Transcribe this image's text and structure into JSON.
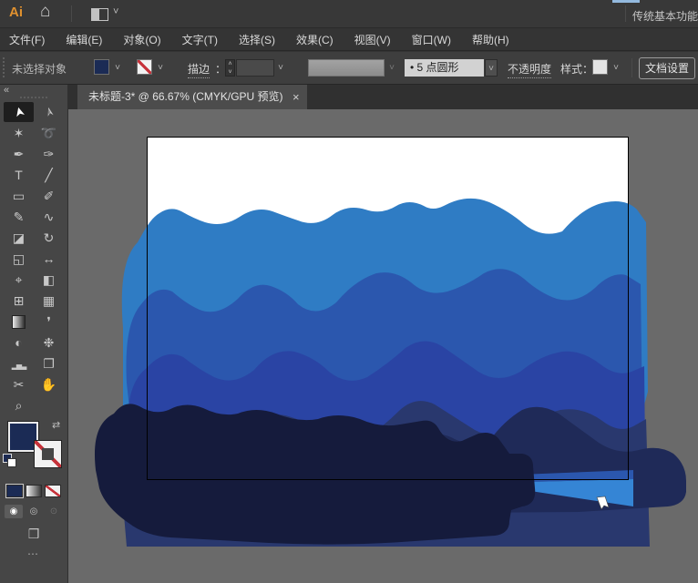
{
  "window": {
    "logo_text": "Ai",
    "workspace_label": "传统基本功能",
    "arrange_chevron": "˅"
  },
  "menu_bar": {
    "items": [
      "文件(F)",
      "编辑(E)",
      "对象(O)",
      "文字(T)",
      "选择(S)",
      "效果(C)",
      "视图(V)",
      "窗口(W)",
      "帮助(H)"
    ]
  },
  "control_bar": {
    "no_selection_label": "未选择对象",
    "fill_color": "#1B2B55",
    "stroke_label": "描边",
    "stroke_colon": "：",
    "stepper_up": "˄",
    "stepper_down": "˅",
    "chevron_glyph": "˅",
    "brush_value": "•  5 点圆形",
    "opacity_label": "不透明度",
    "style_label": "样式：",
    "doc_setup_label": "文档设置"
  },
  "document_tab": {
    "title": "未标题-3*  @  66.67%  (CMYK/GPU 预览)",
    "close_glyph": "×",
    "zoom_percent": "66.67%"
  },
  "toolbar": {
    "collapse_glyph": "«",
    "swap_glyph": "⇄",
    "screen_mode_glyph": "❒",
    "more_glyph": "⋯",
    "drawing_modes": [
      "◉",
      "◎",
      "⊙"
    ],
    "tools": [
      {
        "id": "selection",
        "glyph": "➤",
        "selected": true,
        "cls": "rot"
      },
      {
        "id": "direct-selection",
        "glyph": "➢",
        "cls": "rot"
      },
      {
        "id": "magic-wand",
        "glyph": "✶"
      },
      {
        "id": "lasso",
        "glyph": "➰"
      },
      {
        "id": "pen",
        "glyph": "✒"
      },
      {
        "id": "curvature",
        "glyph": "✑"
      },
      {
        "id": "type",
        "glyph": "T"
      },
      {
        "id": "line-segment",
        "glyph": "╱"
      },
      {
        "id": "rectangle",
        "glyph": "▭"
      },
      {
        "id": "paintbrush",
        "glyph": "✐"
      },
      {
        "id": "pencil",
        "glyph": "✎"
      },
      {
        "id": "shaper",
        "glyph": "∿"
      },
      {
        "id": "eraser",
        "glyph": "◪"
      },
      {
        "id": "rotate",
        "glyph": "↻"
      },
      {
        "id": "scale",
        "glyph": "◱"
      },
      {
        "id": "width",
        "glyph": "↔"
      },
      {
        "id": "puppet-warp",
        "glyph": "⌖"
      },
      {
        "id": "shape-builder",
        "glyph": "◧"
      },
      {
        "id": "perspective-grid",
        "glyph": "⊞"
      },
      {
        "id": "mesh",
        "glyph": "▦"
      },
      {
        "id": "gradient",
        "grad": true
      },
      {
        "id": "eyedropper",
        "glyph": "❜"
      },
      {
        "id": "blend",
        "glyph": "◐"
      },
      {
        "id": "symbol-sprayer",
        "glyph": "❉"
      },
      {
        "id": "column-graph",
        "glyph": "▂▅▃",
        "small": true
      },
      {
        "id": "artboard",
        "glyph": "❐"
      },
      {
        "id": "slice",
        "glyph": "✂"
      },
      {
        "id": "hand",
        "glyph": "✋"
      },
      {
        "id": "zoom",
        "glyph": "⌕"
      }
    ]
  },
  "artwork": {
    "colors": {
      "pasteboard": "#6A6A6A",
      "artboard": "#FFFFFF",
      "artboard_border": "#000000",
      "wave1": "#2F7CC4",
      "wave2": "#2B57AE",
      "wave3": "#2A44A4",
      "wave4": "#29386E",
      "wave5": "#1F2A58",
      "wave6": "#151B3C",
      "wedge_bright": "#3585D5",
      "wedge_top": "#2B57AE",
      "cursor": "#FFFFFF"
    }
  }
}
